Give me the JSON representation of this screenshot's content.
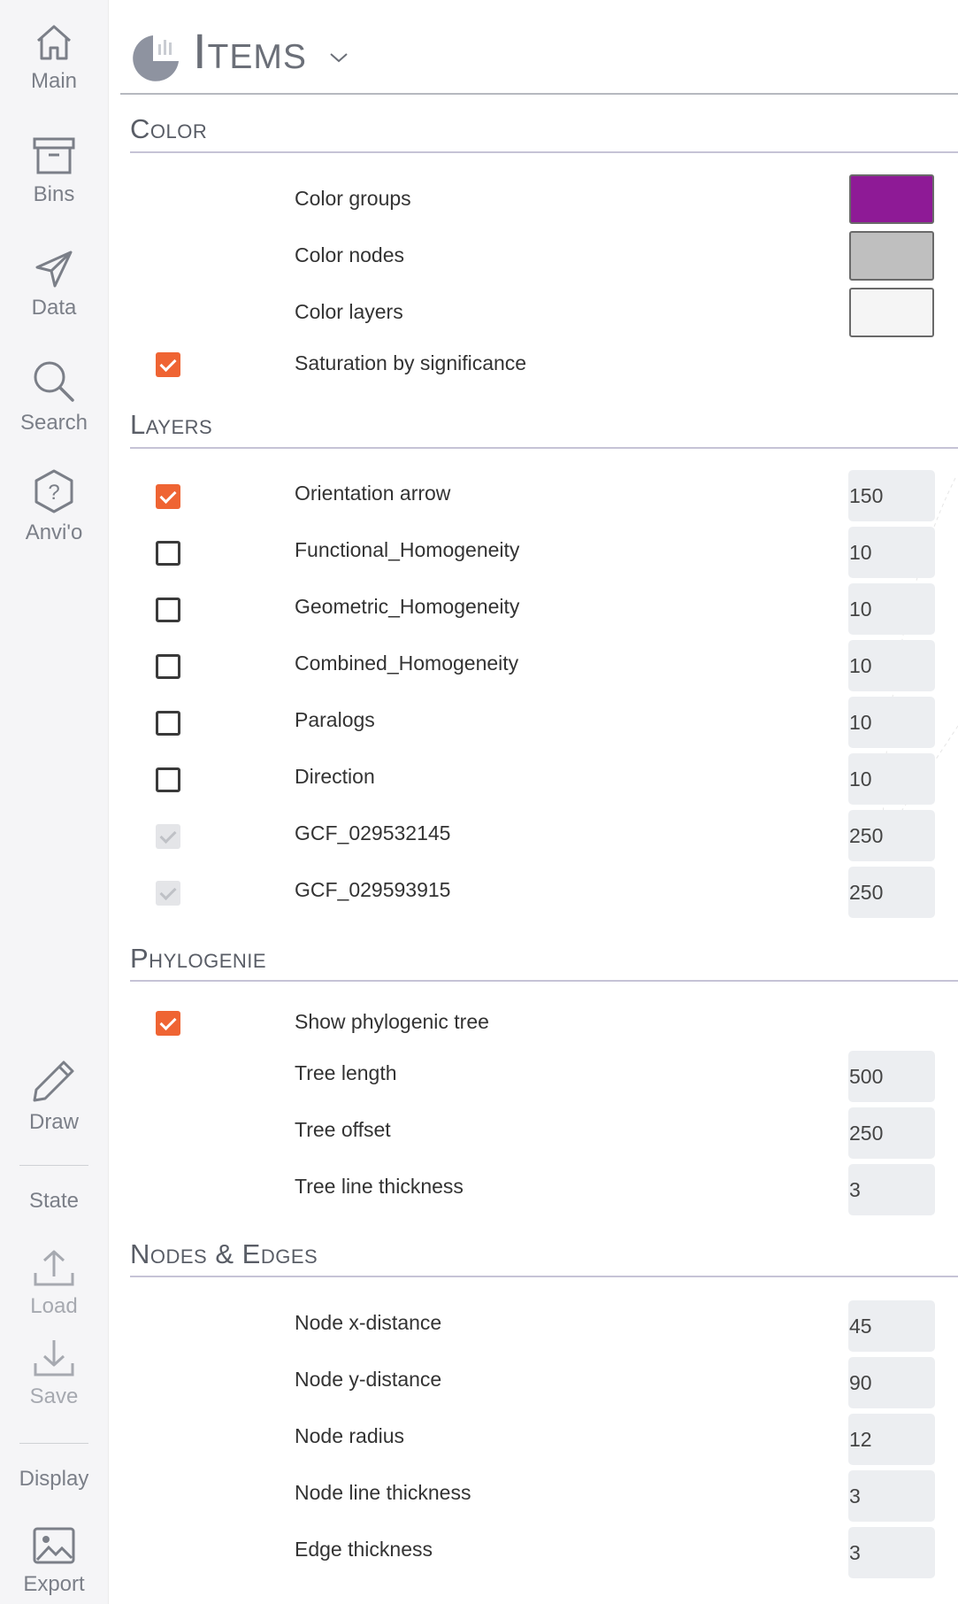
{
  "sidebar": {
    "main": "Main",
    "bins": "Bins",
    "data": "Data",
    "search": "Search",
    "anvio": "Anvi'o",
    "draw": "Draw",
    "state": "State",
    "load": "Load",
    "save": "Save",
    "display": "Display",
    "export": "Export"
  },
  "header": {
    "title": "Items"
  },
  "color": {
    "title": "Color",
    "groups": {
      "label": "Color groups",
      "color": "#8e1a96"
    },
    "nodes": {
      "label": "Color nodes",
      "color": "#bfbfbf"
    },
    "layers": {
      "label": "Color layers",
      "color": "#f5f5f5"
    },
    "saturation": {
      "label": "Saturation by significance",
      "checked": true
    }
  },
  "layers": {
    "title": "Layers",
    "items": [
      {
        "label": "Orientation arrow",
        "value": "150",
        "state": "checked"
      },
      {
        "label": "Functional_Homogeneity",
        "value": "10",
        "state": "unchecked"
      },
      {
        "label": "Geometric_Homogeneity",
        "value": "10",
        "state": "unchecked"
      },
      {
        "label": "Combined_Homogeneity",
        "value": "10",
        "state": "unchecked"
      },
      {
        "label": "Paralogs",
        "value": "10",
        "state": "unchecked"
      },
      {
        "label": "Direction",
        "value": "10",
        "state": "unchecked"
      },
      {
        "label": "GCF_029532145",
        "value": "250",
        "state": "disabled"
      },
      {
        "label": "GCF_029593915",
        "value": "250",
        "state": "disabled"
      }
    ]
  },
  "phylogenie": {
    "title": "Phylogenie",
    "show_tree": {
      "label": "Show phylogenic tree",
      "checked": true
    },
    "tree_length": {
      "label": "Tree length",
      "value": "500"
    },
    "tree_offset": {
      "label": "Tree offset",
      "value": "250"
    },
    "tree_line_thickness": {
      "label": "Tree line thickness",
      "value": "3"
    }
  },
  "nodes_edges": {
    "title": "Nodes & Edges",
    "node_x": {
      "label": "Node x-distance",
      "value": "45"
    },
    "node_y": {
      "label": "Node y-distance",
      "value": "90"
    },
    "node_radius": {
      "label": "Node radius",
      "value": "12"
    },
    "node_line": {
      "label": "Node line thickness",
      "value": "3"
    },
    "edge": {
      "label": "Edge thickness",
      "value": "3"
    }
  },
  "colors": {
    "accent": "#ef6433",
    "icon": "#7b7f88",
    "section_line": "#c6c3d6"
  }
}
